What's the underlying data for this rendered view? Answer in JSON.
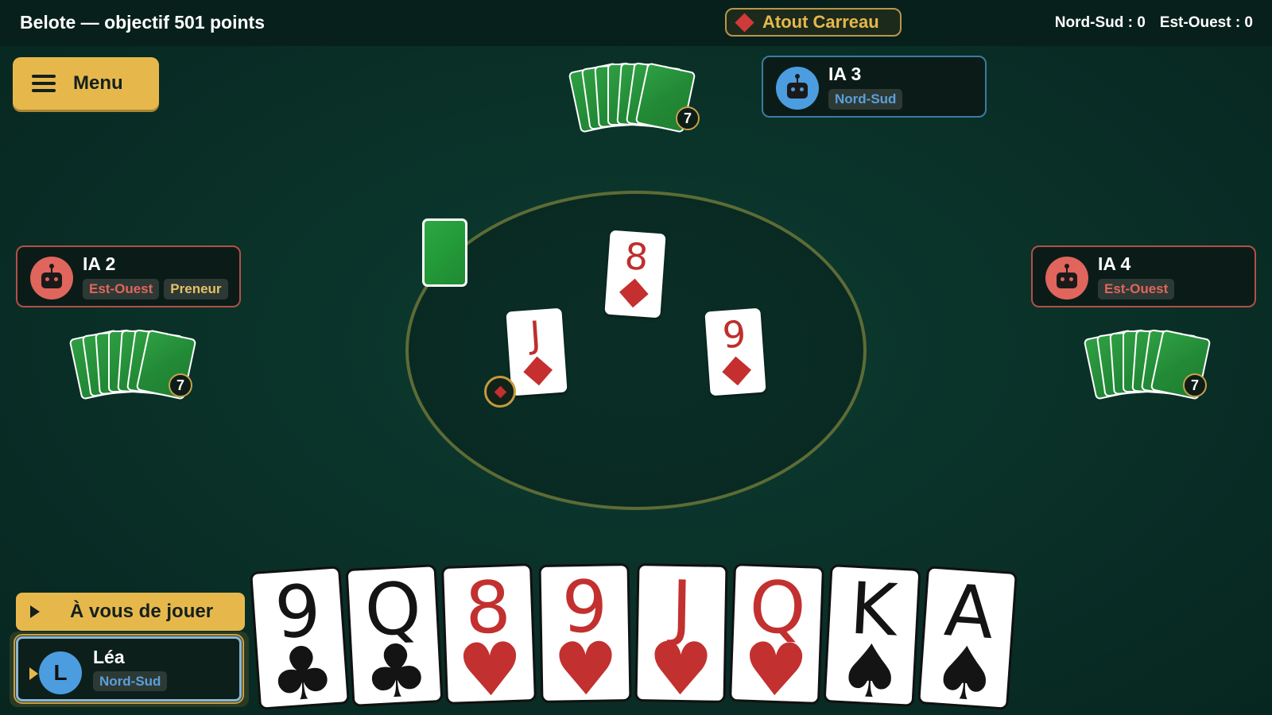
{
  "header": {
    "title": "Belote — objectif 501 points",
    "trump_label": "Atout Carreau",
    "score_ns": "Nord-Sud : 0",
    "score_eo": "Est-Ouest : 0"
  },
  "menu": {
    "label": "Menu"
  },
  "players": {
    "north": {
      "name": "IA 3",
      "team": "Nord-Sud",
      "cards": "7"
    },
    "west": {
      "name": "IA 2",
      "team": "Est-Ouest",
      "role": "Preneur",
      "cards": "7"
    },
    "east": {
      "name": "IA 4",
      "team": "Est-Ouest",
      "cards": "7"
    },
    "me": {
      "initial": "L",
      "name": "Léa",
      "team": "Nord-Sud"
    }
  },
  "trick": [
    {
      "rank": "8",
      "suit": "diamonds"
    },
    {
      "rank": "J",
      "suit": "diamonds"
    },
    {
      "rank": "9",
      "suit": "diamonds"
    }
  ],
  "turn_label": "À vous de jouer",
  "hand": [
    {
      "rank": "9",
      "suit": "♣",
      "suit_name": "clubs"
    },
    {
      "rank": "Q",
      "suit": "♣",
      "suit_name": "clubs"
    },
    {
      "rank": "8",
      "suit": "♥",
      "suit_name": "hearts"
    },
    {
      "rank": "9",
      "suit": "♥",
      "suit_name": "hearts"
    },
    {
      "rank": "J",
      "suit": "♥",
      "suit_name": "hearts"
    },
    {
      "rank": "Q",
      "suit": "♥",
      "suit_name": "hearts"
    },
    {
      "rank": "K",
      "suit": "♠",
      "suit_name": "spades"
    },
    {
      "rank": "A",
      "suit": "♠",
      "suit_name": "spades"
    }
  ],
  "colors": {
    "accent_gold": "#e6b84c",
    "team_ns": "#4c9de0",
    "team_eo": "#e0655c",
    "felt": "#0a3229"
  }
}
